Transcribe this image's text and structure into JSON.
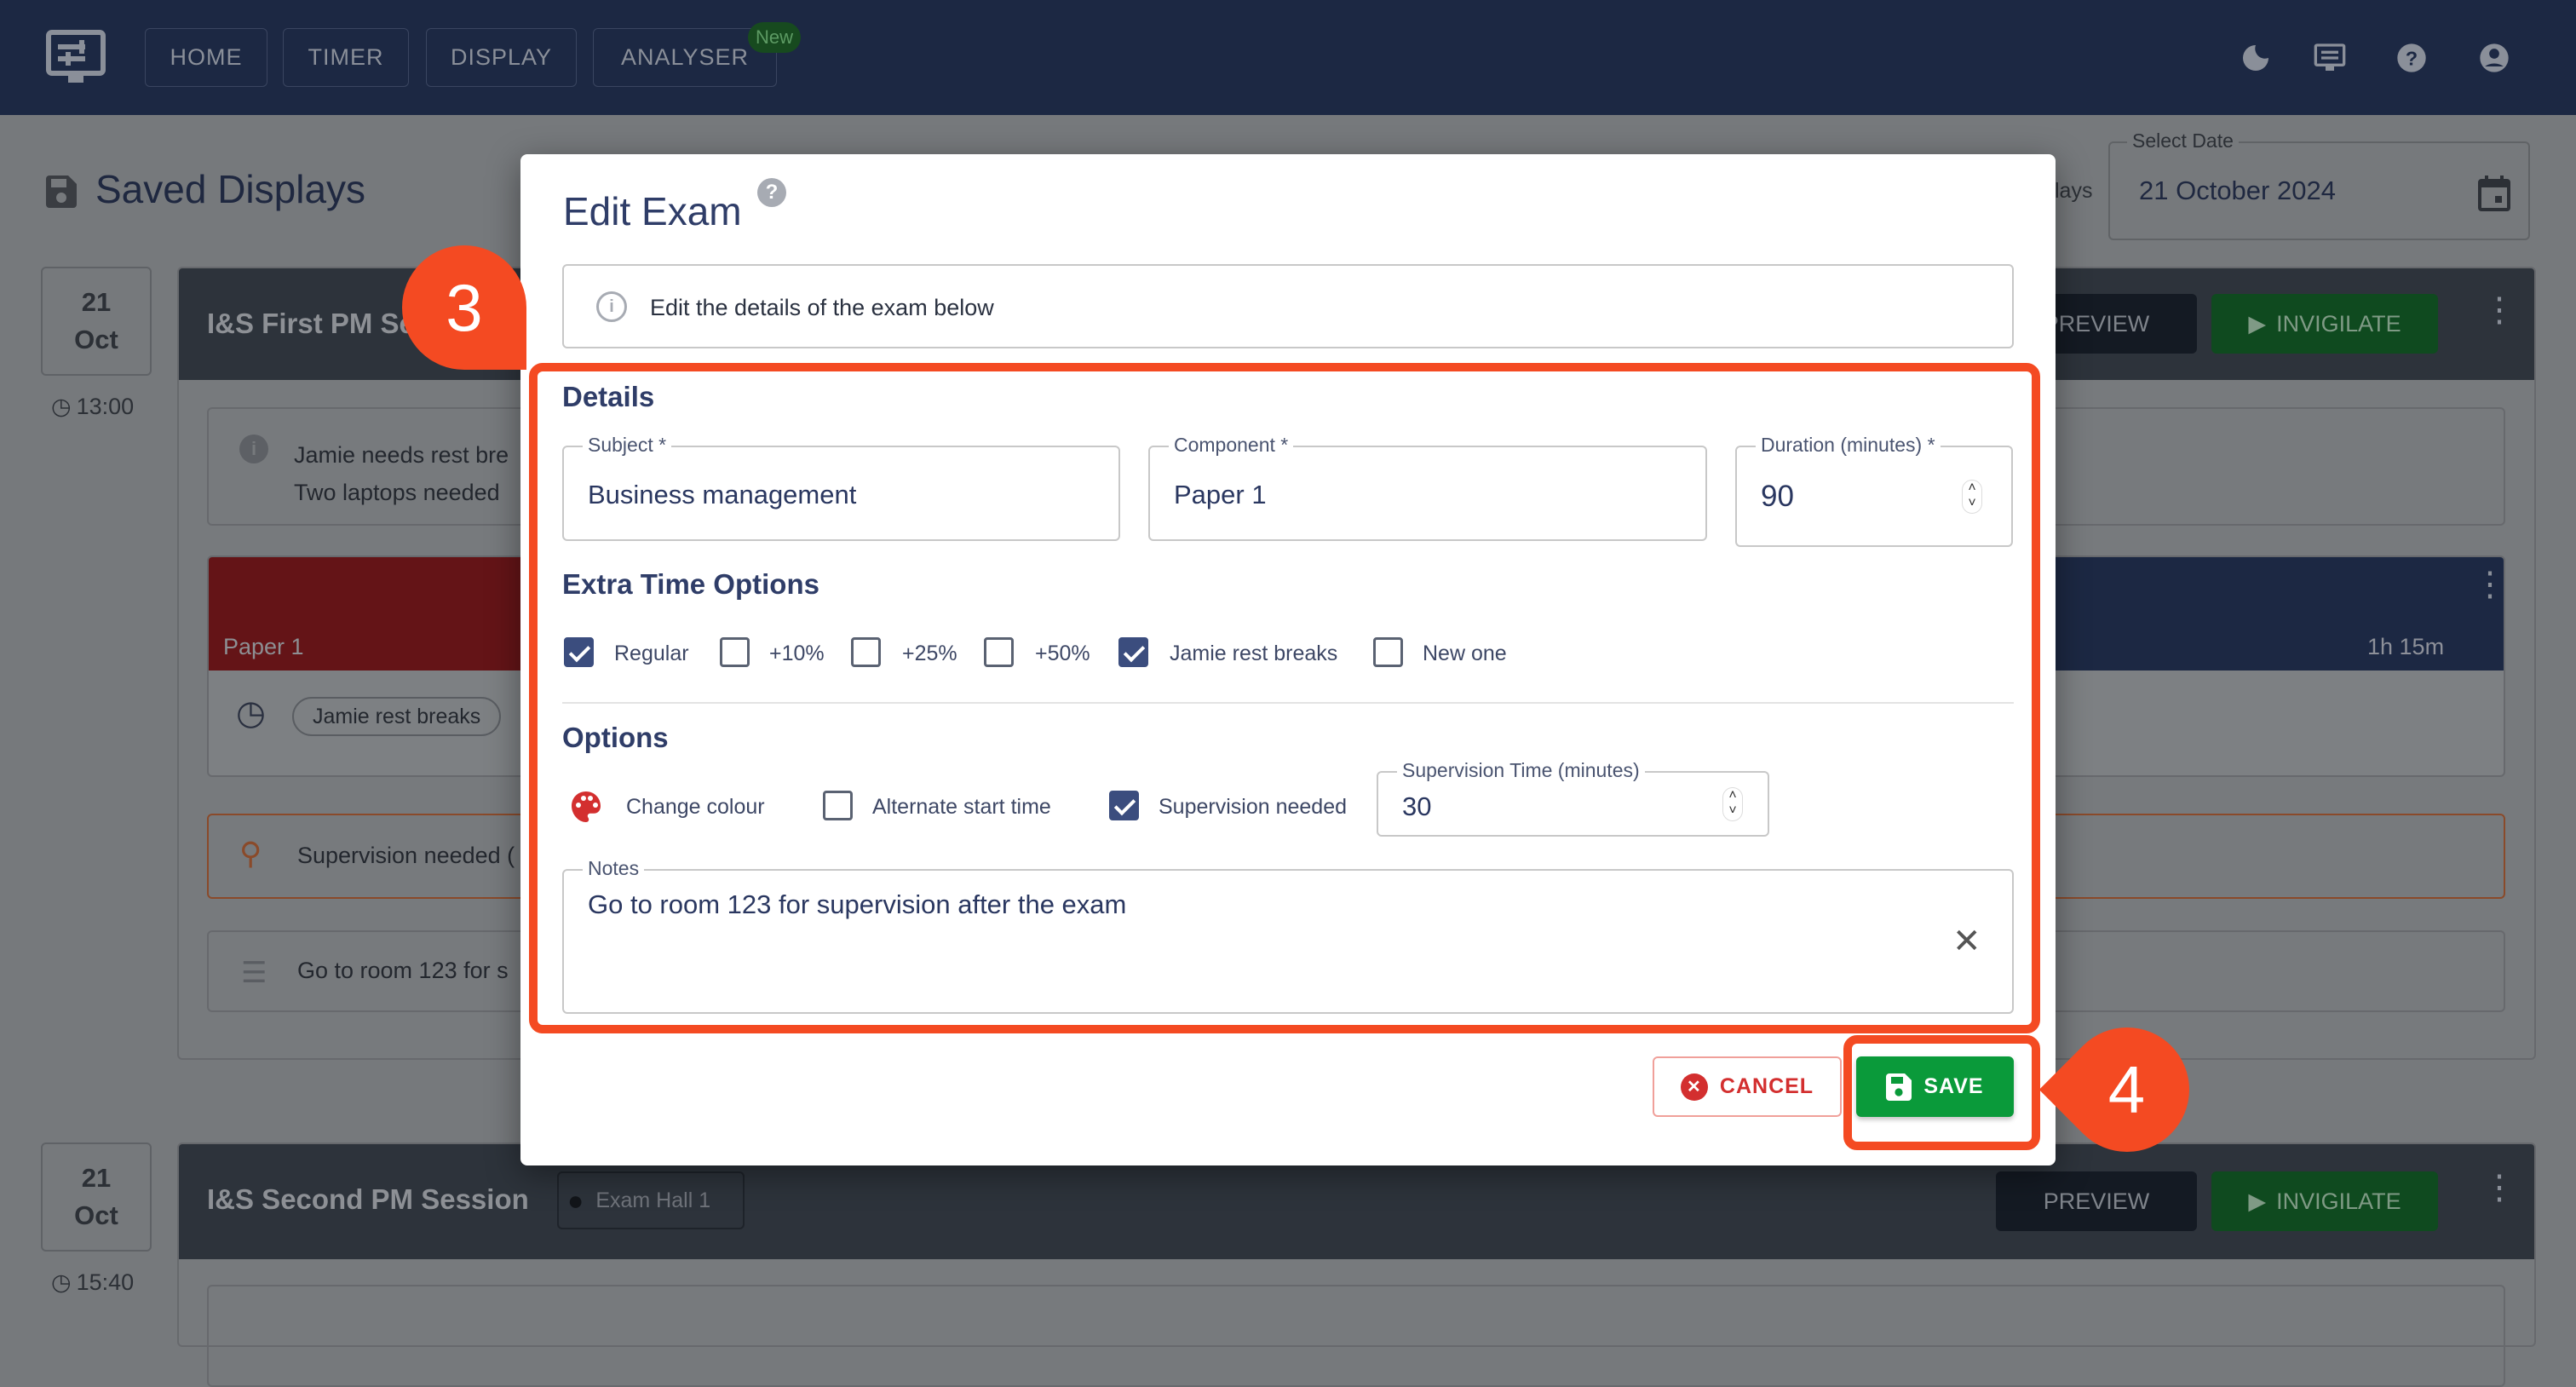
{
  "nav": {
    "items": [
      "HOME",
      "TIMER",
      "DISPLAY",
      "ANALYSER"
    ],
    "new_badge": "New",
    "icons": [
      "theme-moon-icon",
      "display-icon",
      "help-icon",
      "account-icon"
    ]
  },
  "page": {
    "title": "Saved Displays",
    "partial_label": "lays",
    "date_field": {
      "label": "Select Date",
      "value": "21 October 2024"
    }
  },
  "sessions": [
    {
      "day": "21",
      "month": "Oct",
      "time": "13:00",
      "title": "I&S First PM Se",
      "preview": "PREVIEW",
      "invigilate": "INVIGILATE",
      "note_lines": [
        "Jamie needs rest bre",
        "Two laptops needed"
      ],
      "exam": {
        "component": "Paper 1",
        "duration": "1h 15m",
        "chip": "Jamie rest breaks"
      },
      "supervision": "Supervision needed (",
      "notes": "Go to room 123 for s"
    },
    {
      "day": "21",
      "month": "Oct",
      "time": "15:40",
      "title": "I&S Second PM Session",
      "location": "Exam Hall 1",
      "preview": "PREVIEW",
      "invigilate": "INVIGILATE"
    }
  ],
  "dialog": {
    "title": "Edit Exam",
    "info": "Edit the details of the exam below",
    "details_heading": "Details",
    "subject": {
      "label": "Subject *",
      "value": "Business management"
    },
    "component": {
      "label": "Component *",
      "value": "Paper 1"
    },
    "duration": {
      "label": "Duration (minutes) *",
      "value": "90"
    },
    "extra_time_heading": "Extra Time Options",
    "extra_time": [
      {
        "label": "Regular",
        "checked": true
      },
      {
        "label": "+10%",
        "checked": false
      },
      {
        "label": "+25%",
        "checked": false
      },
      {
        "label": "+50%",
        "checked": false
      },
      {
        "label": "Jamie rest breaks",
        "checked": true
      },
      {
        "label": "New one",
        "checked": false
      }
    ],
    "options_heading": "Options",
    "change_colour": "Change colour",
    "alternate_start": {
      "label": "Alternate start time",
      "checked": false
    },
    "supervision_needed": {
      "label": "Supervision needed",
      "checked": true
    },
    "supervision_time": {
      "label": "Supervision Time (minutes)",
      "value": "30"
    },
    "notes": {
      "label": "Notes",
      "value": "Go to room 123 for supervision after the exam"
    },
    "cancel": "CANCEL",
    "save": "SAVE"
  },
  "markers": {
    "step3": "3",
    "step4": "4"
  },
  "colors": {
    "highlight": "#f44a22",
    "save": "#0a9a3a",
    "cancel": "#d32f2f",
    "accent": "#3b4d7e"
  }
}
